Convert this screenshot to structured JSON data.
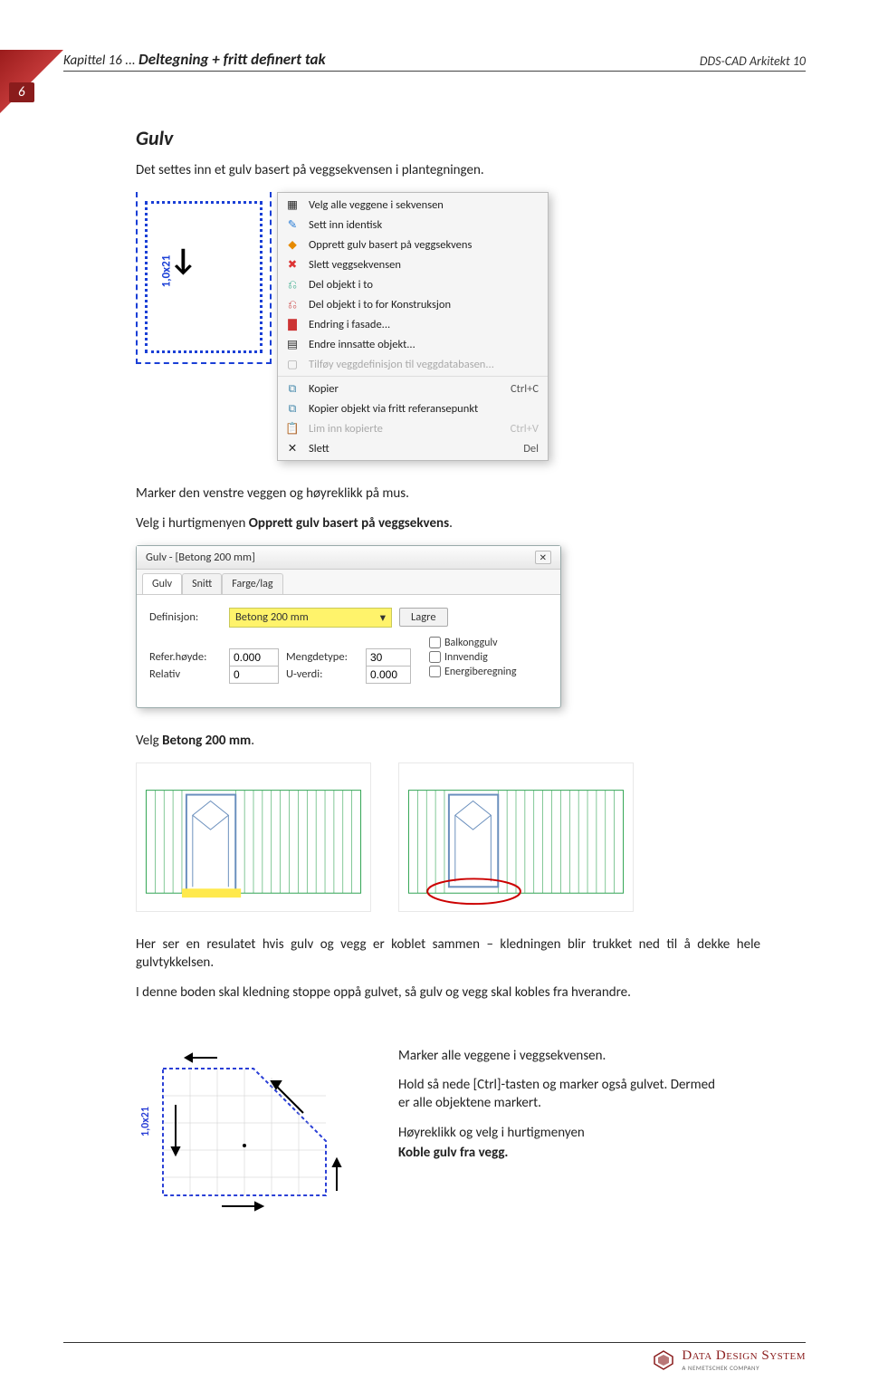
{
  "page_number": "6",
  "header": {
    "chapter_prefix": "Kapittel 16 ...",
    "chapter_title": "Deltegning + fritt definert tak",
    "product": "DDS-CAD Arkitekt 10"
  },
  "section": {
    "title": "Gulv",
    "intro": "Det settes inn et gulv basert på veggsekvensen i plantegningen.",
    "plan_label": "1,0x21",
    "context_menu": [
      {
        "label": "Velg alle veggene i sekvensen",
        "icon": "select-all-walls-icon"
      },
      {
        "label": "Sett inn identisk",
        "icon": "insert-identical-icon"
      },
      {
        "label": "Opprett gulv basert på veggsekvens",
        "icon": "create-floor-icon"
      },
      {
        "label": "Slett veggsekvensen",
        "icon": "delete-sequence-icon"
      },
      {
        "label": "Del objekt i to",
        "icon": "split-object-icon"
      },
      {
        "label": "Del objekt i to for Konstruksjon",
        "icon": "split-construction-icon"
      },
      {
        "label": "Endring i fasade...",
        "icon": "facade-change-icon"
      },
      {
        "label": "Endre innsatte objekt...",
        "icon": "edit-inserted-icon"
      },
      {
        "label": "Tilføy veggdefinisjon til veggdatabasen...",
        "icon": "add-walldef-icon",
        "disabled": true
      },
      {
        "label": "Kopier",
        "icon": "copy-icon",
        "shortcut": "Ctrl+C"
      },
      {
        "label": "Kopier objekt via fritt referansepunkt",
        "icon": "copy-refpoint-icon"
      },
      {
        "label": "Lim inn kopierte",
        "icon": "paste-icon",
        "shortcut": "Ctrl+V",
        "disabled": true
      },
      {
        "label": "Slett",
        "icon": "delete-icon",
        "shortcut": "Del"
      }
    ],
    "para2_a": "Marker den venstre veggen og høyreklikk på mus.",
    "para2_b_pre": "Velg i hurtigmenyen ",
    "para2_b_bold": "Opprett gulv basert på veggsekvens",
    "dialog": {
      "title": "Gulv - [Betong 200 mm]",
      "tabs": [
        "Gulv",
        "Snitt",
        "Farge/lag"
      ],
      "definition_label": "Definisjon:",
      "definition_value": "Betong 200 mm",
      "save_btn": "Lagre",
      "ref_height_label": "Refer.høyde:",
      "ref_height_value": "0.000",
      "mengdetype_label": "Mengdetype:",
      "mengdetype_value": "30",
      "relativ_label": "Relativ",
      "relativ_value": "0",
      "uverdi_label": "U-verdi:",
      "uverdi_value": "0.000",
      "check1": "Balkonggulv",
      "check2": "Innvendig",
      "check3": "Energiberegning"
    },
    "para3_pre": "Velg ",
    "para3_bold": "Betong 200 mm",
    "para4_a": "Her ser en resulatet hvis gulv og vegg er koblet sammen – kledningen blir trukket ned til å dekke hele gulvtykkelsen.",
    "para4_b": "I denne boden skal kledning stoppe oppå gulvet, så gulv og vegg skal kobles fra hverandre.",
    "side": {
      "line1": "Marker alle veggene i veggsekvensen.",
      "line2": "Hold så nede [Ctrl]-tasten og marker også gulvet. Dermed er alle objektene markert.",
      "line3": "Høyreklikk og velg i hurtigmenyen",
      "line4": "Koble gulv fra vegg."
    }
  },
  "footer": {
    "brand": "Data Design System",
    "sub": "A NEMETSCHEK COMPANY"
  }
}
